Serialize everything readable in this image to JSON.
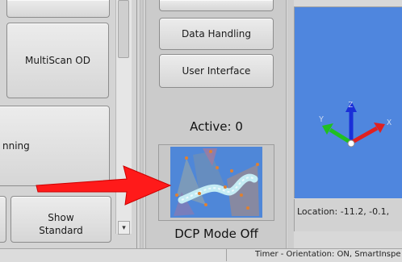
{
  "left_panel": {
    "multiscan_label": "MultiScan OD",
    "partial_label": "nning",
    "show_standard_label": "Show\nStandard"
  },
  "middle_panel": {
    "data_handling_label": "Data Handling",
    "user_interface_label": "User Interface",
    "active_label": "Active: 0",
    "dcp_mode_label": "DCP Mode Off"
  },
  "viewport": {
    "axis_labels": {
      "x": "X",
      "y": "Y",
      "z": "Z"
    },
    "colors": {
      "x": "#e02020",
      "y": "#20c020",
      "z": "#1a2fd8",
      "background": "#4f86de"
    }
  },
  "location": {
    "text": "Location: -11.2, -0.1,"
  },
  "status_bar": {
    "text": "Timer - Orientation: ON, SmartInspe"
  },
  "annotation": {
    "arrow_color": "#ff1a1a"
  },
  "icons": {
    "scroll_down": "chevron-down-icon",
    "axis_triad": "axis-triad-icon",
    "dcp_preview": "dcp-path-preview-icon",
    "callout_arrow": "red-arrow-icon"
  }
}
